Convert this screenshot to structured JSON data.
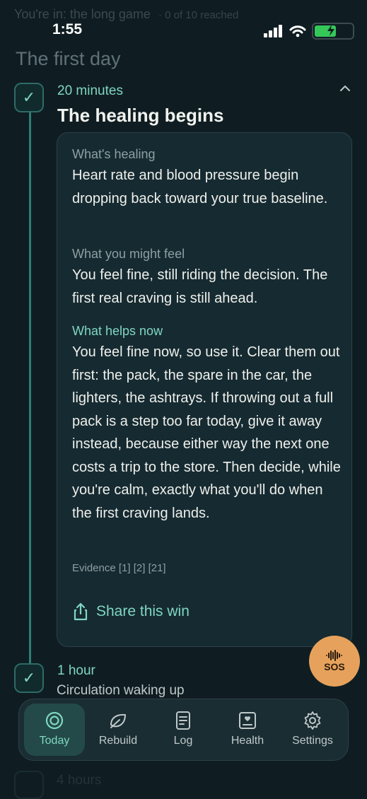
{
  "header": {
    "faded_title": "You're in: the long game",
    "faded_sub": "· 0 of 10 reached"
  },
  "status_bar": {
    "time": "1:55"
  },
  "section": {
    "title": "The first day"
  },
  "milestones": [
    {
      "time": "20 minutes",
      "title": "The healing begins",
      "card": {
        "healing_label": "What's healing",
        "healing_text": "Heart rate and blood pressure begin dropping back toward your true baseline.",
        "feel_label": "What you might feel",
        "feel_text": "You feel fine, still riding the decision. The first real craving is still ahead.",
        "helps_label": "What helps now",
        "helps_text": "You feel fine now, so use it. Clear them out first: the pack, the spare in the car, the lighters, the ashtrays. If throwing out a full pack is a step too far today, give it away instead, because either way the next one costs a trip to the store. Then decide, while you're calm, exactly what you'll do when the first craving lands.",
        "evidence": "Evidence [1] [2] [21]",
        "share_label": "Share this win"
      }
    },
    {
      "time": "1 hour",
      "title": "Circulation waking up"
    },
    {
      "time": "4 hours"
    }
  ],
  "sos": {
    "label": "SOS"
  },
  "tabs": [
    {
      "label": "Today",
      "icon": "target-icon"
    },
    {
      "label": "Rebuild",
      "icon": "leaf-icon"
    },
    {
      "label": "Log",
      "icon": "document-icon"
    },
    {
      "label": "Health",
      "icon": "health-card-icon"
    },
    {
      "label": "Settings",
      "icon": "gear-icon"
    }
  ],
  "colors": {
    "background": "#0f1d22",
    "accent": "#7fd6c1",
    "card": "#162a31",
    "sos": "#e6a25c"
  }
}
